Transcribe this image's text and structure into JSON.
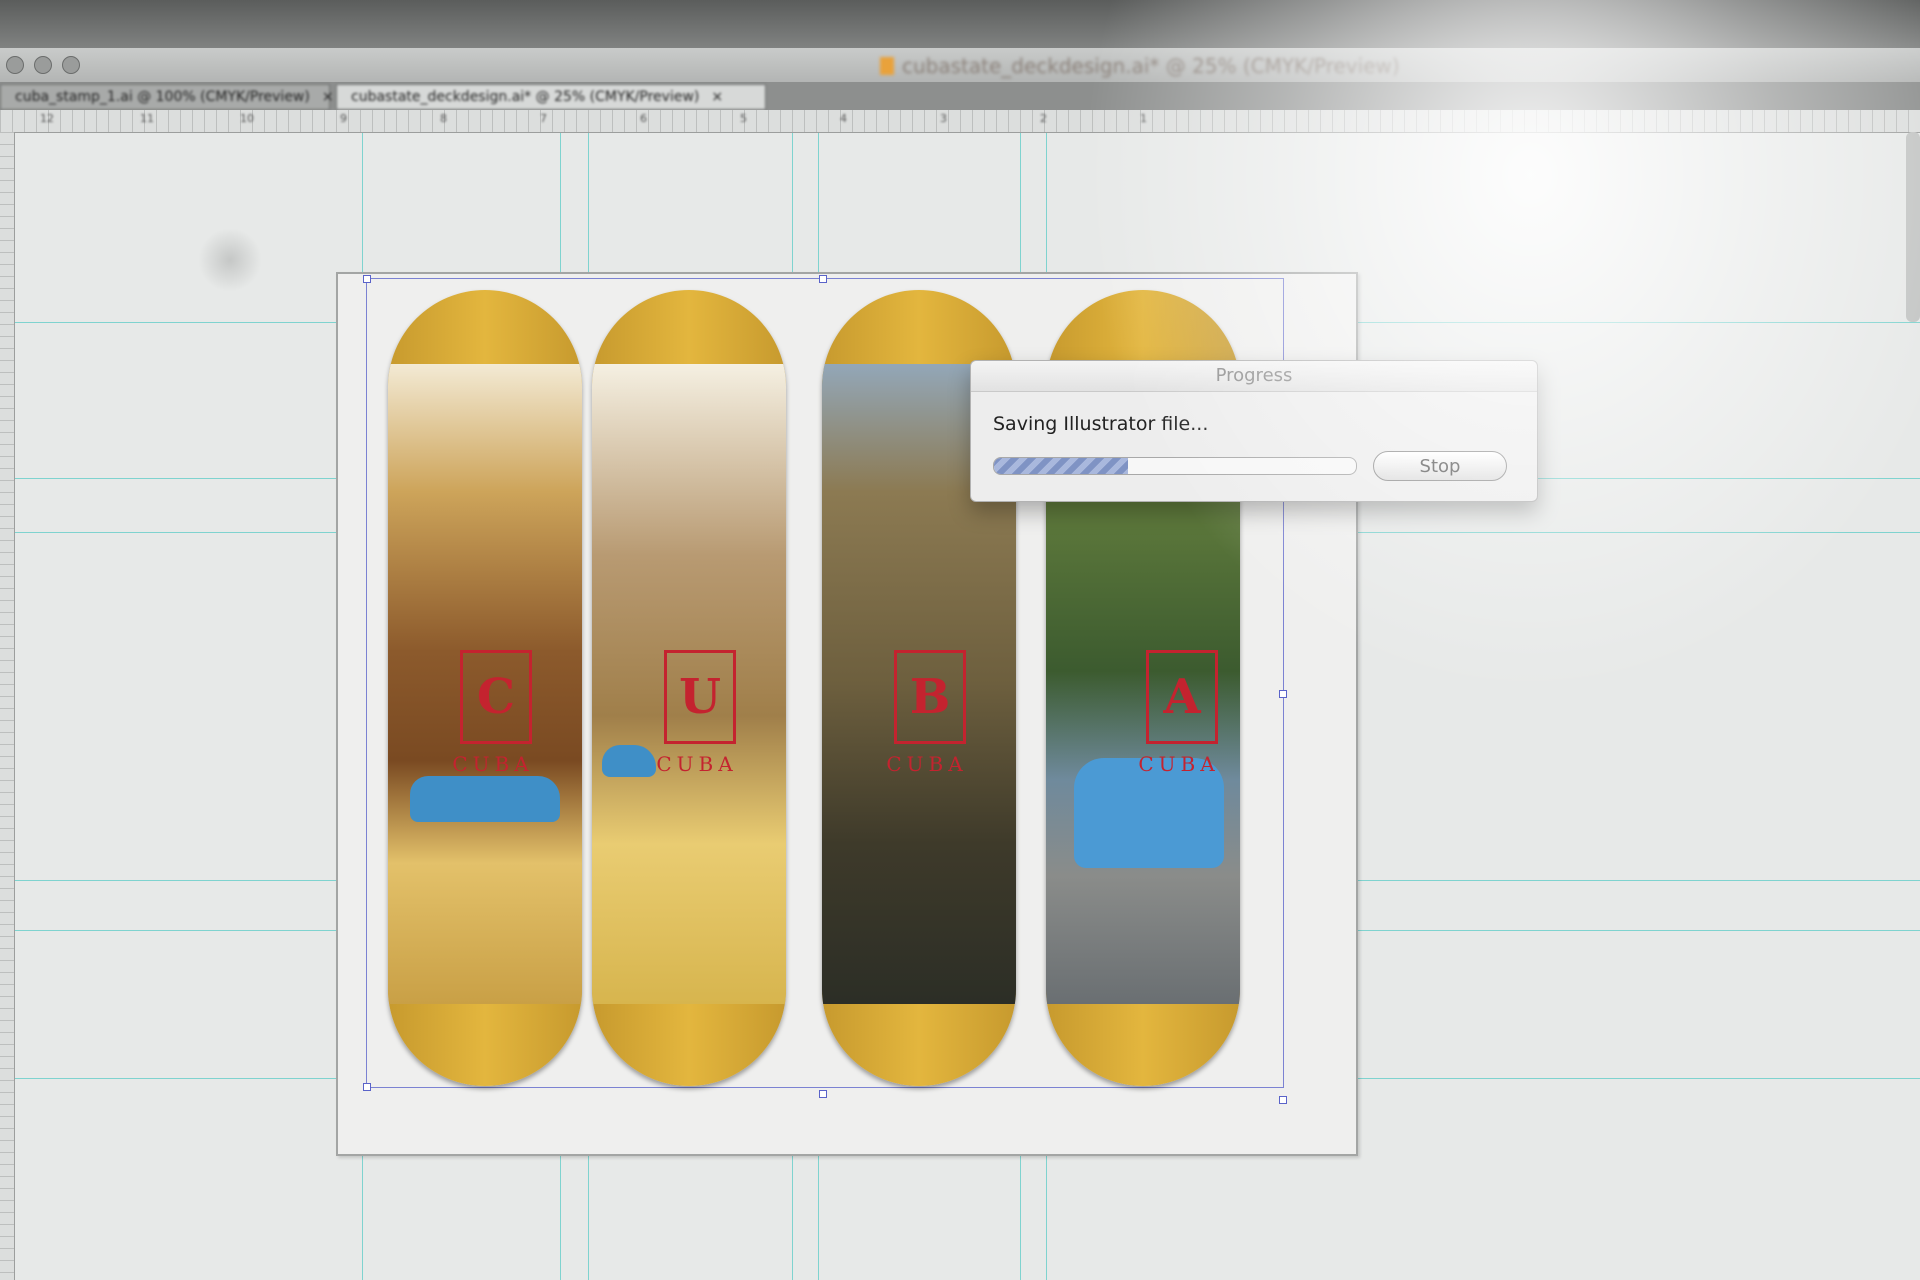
{
  "window": {
    "document_title": "cubastate_deckdesign.ai* @ 25% (CMYK/Preview)"
  },
  "tabs": [
    {
      "label": "cuba_stamp_1.ai @ 100% (CMYK/Preview)",
      "close": "×"
    },
    {
      "label": "cubastate_deckdesign.ai* @ 25% (CMYK/Preview)",
      "close": "×"
    }
  ],
  "ruler": {
    "marks": [
      "12",
      "11",
      "10",
      "9",
      "8",
      "7",
      "6",
      "5",
      "4",
      "3",
      "2",
      "1"
    ]
  },
  "decks": [
    {
      "stamp_letter": "C",
      "stamp_word": "CUBA"
    },
    {
      "stamp_letter": "U",
      "stamp_word": "CUBA"
    },
    {
      "stamp_letter": "B",
      "stamp_word": "CUBA"
    },
    {
      "stamp_letter": "A",
      "stamp_word": "CUBA"
    }
  ],
  "dialog": {
    "title": "Progress",
    "message": "Saving Illustrator file...",
    "progress": 0.37,
    "stop_label": "Stop"
  },
  "colors": {
    "guide": "#7fd3cf",
    "stamp_red": "#c4232f",
    "deck_wood": "#e3b63e",
    "selection": "#7b82d2"
  }
}
